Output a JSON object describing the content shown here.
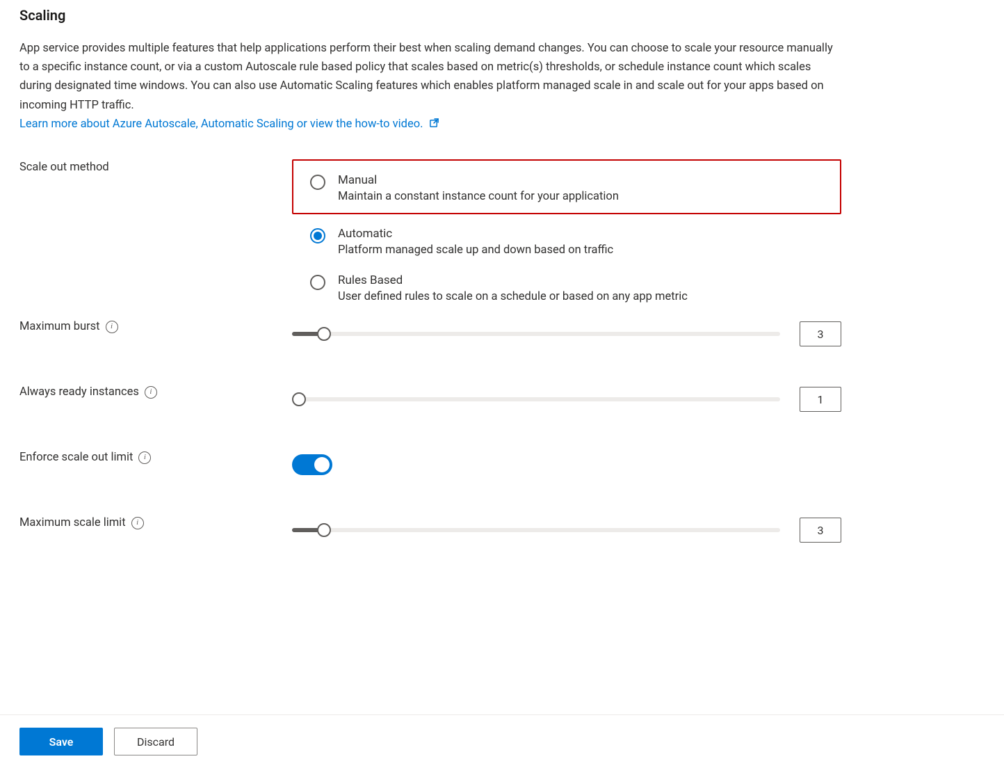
{
  "section_title": "Scaling",
  "intro_text": "App service provides multiple features that help applications perform their best when scaling demand changes. You can choose to scale your resource manually to a specific instance count, or via a custom Autoscale rule based policy that scales based on metric(s) thresholds, or schedule instance count which scales during designated time windows. You can also use Automatic Scaling features which enables platform managed scale in and scale out for your apps based on incoming HTTP traffic.",
  "learn_more_link": "Learn more about Azure Autoscale, Automatic Scaling or view the how-to video.",
  "labels": {
    "scale_out_method": "Scale out method",
    "maximum_burst": "Maximum burst",
    "always_ready_instances": "Always ready instances",
    "enforce_scale_out_limit": "Enforce scale out limit",
    "maximum_scale_limit": "Maximum scale limit"
  },
  "scale_methods": {
    "manual": {
      "title": "Manual",
      "desc": "Maintain a constant instance count for your application",
      "selected": false,
      "highlighted": true
    },
    "automatic": {
      "title": "Automatic",
      "desc": "Platform managed scale up and down based on traffic",
      "selected": true
    },
    "rules_based": {
      "title": "Rules Based",
      "desc": "User defined rules to scale on a schedule or based on any app metric",
      "selected": false
    }
  },
  "values": {
    "maximum_burst": "3",
    "always_ready_instances": "1",
    "enforce_scale_out_limit": true,
    "maximum_scale_limit": "3"
  },
  "buttons": {
    "save": "Save",
    "discard": "Discard"
  }
}
